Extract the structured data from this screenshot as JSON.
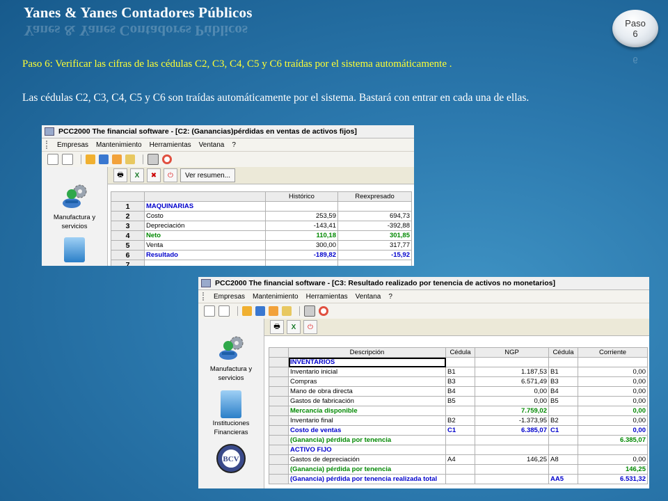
{
  "header": {
    "title": "Yanes & Yanes Contadores Públicos",
    "badge_line1": "Paso",
    "badge_line2": "6",
    "badge_reflect": "6"
  },
  "text": {
    "instruction": "Paso 6: Verificar las cifras de las cédulas C2, C3, C4, C5 y C6 traídas por el sistema automáticamente .",
    "description": "Las cédulas C2, C3, C4, C5 y C6 son traídas automáticamente por el sistema. Bastará con entrar en cada una de ellas."
  },
  "colors": {
    "instruction": "#ffff33",
    "accent_blue": "#0000cc",
    "accent_green": "#008800"
  },
  "window1": {
    "title": "PCC2000 The financial software - [C2: (Ganancias)pérdidas en ventas de activos fijos]",
    "menu": [
      "Empresas",
      "Mantenimiento",
      "Herramientas",
      "Ventana",
      "?"
    ],
    "sidebar": [
      {
        "label1": "Manufactura y",
        "label2": "servicios",
        "icon": "gear-person-icon"
      }
    ],
    "ver_resumen": "Ver resumen...",
    "columns": [
      "Histórico",
      "Reexpresado"
    ],
    "rows": [
      {
        "n": "1",
        "desc": "MAQUINARIAS",
        "hist": "",
        "reex": "",
        "style": "blue"
      },
      {
        "n": "2",
        "desc": "Costo",
        "hist": "253,59",
        "reex": "694,73",
        "style": ""
      },
      {
        "n": "3",
        "desc": "Depreciación",
        "hist": "-143,41",
        "reex": "-392,88",
        "style": ""
      },
      {
        "n": "4",
        "desc": "Neto",
        "hist": "110,18",
        "reex": "301,85",
        "style": "green"
      },
      {
        "n": "5",
        "desc": "Venta",
        "hist": "300,00",
        "reex": "317,77",
        "style": ""
      },
      {
        "n": "6",
        "desc": "Resultado",
        "hist": "-189,82",
        "reex": "-15,92",
        "style": "blue"
      },
      {
        "n": "7",
        "desc": "",
        "hist": "",
        "reex": "",
        "style": ""
      }
    ]
  },
  "window2": {
    "title": "PCC2000 The financial software - [C3: Resultado realizado por tenencia de activos no monetarios]",
    "menu": [
      "Empresas",
      "Mantenimiento",
      "Herramientas",
      "Ventana",
      "?"
    ],
    "sidebar": [
      {
        "label1": "Manufactura y",
        "label2": "servicios",
        "icon": "gear-person-icon"
      },
      {
        "label1": "Instituciones",
        "label2": "Financieras",
        "icon": "cabinet-icon"
      },
      {
        "label1": "",
        "label2": "",
        "icon": "bcv-seal-icon"
      }
    ],
    "bcv_text": "BCV",
    "columns": [
      "Descripción",
      "Cédula",
      "NGP",
      "Cédula",
      "Corriente"
    ],
    "rows": [
      {
        "desc": "INVENTARIOS",
        "c1": "",
        "ngp": "",
        "c2": "",
        "corr": "",
        "style": "blue",
        "sel": true
      },
      {
        "desc": "Inventario inicial",
        "c1": "B1",
        "ngp": "1.187,53",
        "c2": "B1",
        "corr": "0,00",
        "style": ""
      },
      {
        "desc": "Compras",
        "c1": "B3",
        "ngp": "6.571,49",
        "c2": "B3",
        "corr": "0,00",
        "style": ""
      },
      {
        "desc": "Mano de obra directa",
        "c1": "B4",
        "ngp": "0,00",
        "c2": "B4",
        "corr": "0,00",
        "style": ""
      },
      {
        "desc": "Gastos de fabricación",
        "c1": "B5",
        "ngp": "0,00",
        "c2": "B5",
        "corr": "0,00",
        "style": ""
      },
      {
        "desc": "Mercancía disponible",
        "c1": "",
        "ngp": "7.759,02",
        "c2": "",
        "corr": "0,00",
        "style": "green"
      },
      {
        "desc": "Inventario final",
        "c1": "B2",
        "ngp": "-1.373,95",
        "c2": "B2",
        "corr": "0,00",
        "style": ""
      },
      {
        "desc": "Costo de ventas",
        "c1": "C1",
        "ngp": "6.385,07",
        "c2": "C1",
        "corr": "0,00",
        "style": "blue"
      },
      {
        "desc": "(Ganancia) pérdida por tenencia",
        "c1": "",
        "ngp": "",
        "c2": "",
        "corr": "6.385,07",
        "style": "green"
      },
      {
        "desc": "ACTIVO FIJO",
        "c1": "",
        "ngp": "",
        "c2": "",
        "corr": "",
        "style": "blue"
      },
      {
        "desc": "Gastos de depreciación",
        "c1": "A4",
        "ngp": "146,25",
        "c2": "A8",
        "corr": "0,00",
        "style": ""
      },
      {
        "desc": "(Ganancia) pérdida por tenencia",
        "c1": "",
        "ngp": "",
        "c2": "",
        "corr": "146,25",
        "style": "green"
      },
      {
        "desc": "(Ganancia) pérdida por tenencia realizada total",
        "c1": "",
        "ngp": "",
        "c2": "AA5",
        "corr": "6.531,32",
        "style": "blue"
      }
    ]
  }
}
